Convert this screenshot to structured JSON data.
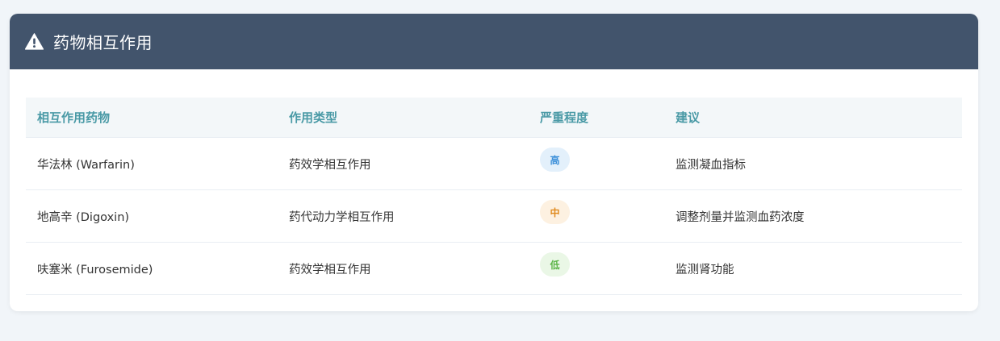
{
  "header": {
    "title": "药物相互作用",
    "icon": "warning-icon"
  },
  "table": {
    "columns": [
      "相互作用药物",
      "作用类型",
      "严重程度",
      "建议"
    ],
    "rows": [
      {
        "drug": "华法林 (Warfarin)",
        "type": "药效学相互作用",
        "severity": "高",
        "advice": "监测凝血指标"
      },
      {
        "drug": "地高辛 (Digoxin)",
        "type": "药代动力学相互作用",
        "severity": "中",
        "advice": "调整剂量并监测血药浓度"
      },
      {
        "drug": "呋塞米 (Furosemide)",
        "type": "药效学相互作用",
        "severity": "低",
        "advice": "监测肾功能"
      }
    ]
  },
  "colors": {
    "header_bg": "#42546c",
    "column_header_text": "#4a9aa6",
    "severity_high_bg": "#e3f0fb",
    "severity_high_text": "#3b8fd9",
    "severity_medium_bg": "#fdf1e1",
    "severity_medium_text": "#e08a1e",
    "severity_low_bg": "#eaf7e6",
    "severity_low_text": "#5cb548"
  }
}
